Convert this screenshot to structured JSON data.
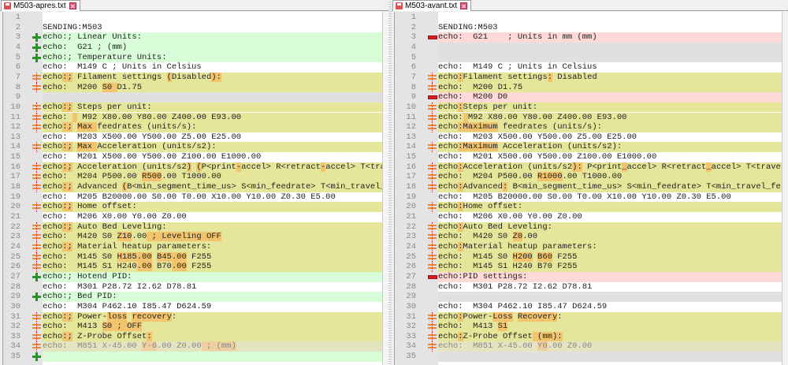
{
  "left": {
    "tab_label": "M503-apres.txt",
    "lines": [
      {
        "n": "1",
        "type": "normal",
        "segs": []
      },
      {
        "n": "2",
        "type": "normal",
        "segs": [
          {
            "t": "SENDING:M503"
          }
        ]
      },
      {
        "n": "3",
        "type": "add",
        "segs": [
          {
            "t": "echo:; Linear Units:"
          }
        ]
      },
      {
        "n": "4",
        "type": "add",
        "segs": [
          {
            "t": "echo:  G21 ; (mm)"
          }
        ]
      },
      {
        "n": "5",
        "type": "add",
        "segs": [
          {
            "t": "echo:; Temperature Units:"
          }
        ]
      },
      {
        "n": "6",
        "type": "normal",
        "segs": [
          {
            "t": "echo:  M149 C ; Units in Celsius"
          }
        ]
      },
      {
        "n": "7",
        "type": "chg",
        "segs": [
          {
            "t": "echo"
          },
          {
            "t": ":;",
            "h": true
          },
          {
            "t": " Filament settings "
          },
          {
            "t": "(",
            "h": true
          },
          {
            "t": "Disabled"
          },
          {
            "t": "):",
            "h": true
          }
        ]
      },
      {
        "n": "8",
        "type": "chg",
        "segs": [
          {
            "t": "echo:  M200 "
          },
          {
            "t": "S0 ",
            "h": true
          },
          {
            "t": "D1.75"
          }
        ]
      },
      {
        "n": "9",
        "type": "gap",
        "segs": []
      },
      {
        "n": "10",
        "type": "chg",
        "segs": [
          {
            "t": "echo"
          },
          {
            "t": ":;",
            "h": true
          },
          {
            "t": " Steps per unit:"
          }
        ]
      },
      {
        "n": "11",
        "type": "chg",
        "segs": [
          {
            "t": "echo: "
          },
          {
            "t": " ",
            "h": true
          },
          {
            "t": " M92 X80.00 Y80.00 Z400.00 E93.00"
          }
        ]
      },
      {
        "n": "12",
        "type": "chg",
        "segs": [
          {
            "t": "echo"
          },
          {
            "t": ":;",
            "h": true
          },
          {
            "t": " "
          },
          {
            "t": "Max ",
            "h": true
          },
          {
            "t": "feedrates (units/s):"
          }
        ]
      },
      {
        "n": "13",
        "type": "normal",
        "segs": [
          {
            "t": "echo:  M203 X500.00 Y500.00 Z5.00 E25.00"
          }
        ]
      },
      {
        "n": "14",
        "type": "chg",
        "segs": [
          {
            "t": "echo"
          },
          {
            "t": ":;",
            "h": true
          },
          {
            "t": " "
          },
          {
            "t": "Max ",
            "h": true
          },
          {
            "t": "Acceleration (units/s2):"
          }
        ]
      },
      {
        "n": "15",
        "type": "normal",
        "segs": [
          {
            "t": "echo:  M201 X500.00 Y500.00 Z100.00 E1000.00"
          }
        ]
      },
      {
        "n": "16",
        "type": "chg",
        "segs": [
          {
            "t": "echo"
          },
          {
            "t": ":;",
            "h": true
          },
          {
            "t": " Acceleration (units/s2"
          },
          {
            "t": ")",
            "h": true
          },
          {
            "t": " "
          },
          {
            "t": "(",
            "h": true
          },
          {
            "t": "P<print"
          },
          {
            "t": "-",
            "h": true
          },
          {
            "t": "accel> R<retract"
          },
          {
            "t": "-",
            "h": true
          },
          {
            "t": "accel> T<tra"
          }
        ]
      },
      {
        "n": "17",
        "type": "chg",
        "segs": [
          {
            "t": "echo:  M204 P500.00 "
          },
          {
            "t": "R500",
            "h": true
          },
          {
            "t": ".00 T1000.00"
          }
        ]
      },
      {
        "n": "18",
        "type": "chg",
        "segs": [
          {
            "t": "echo"
          },
          {
            "t": ":;",
            "h": true
          },
          {
            "t": " Advanced "
          },
          {
            "t": "(",
            "h": true
          },
          {
            "t": "B<min_segment_time_us> S<min_feedrate> T<min_travel_"
          }
        ]
      },
      {
        "n": "19",
        "type": "normal",
        "segs": [
          {
            "t": "echo:  M205 B20000.00 S0.00 T0.00 X10.00 Y10.00 Z0.30 E5.00"
          }
        ]
      },
      {
        "n": "20",
        "type": "chg",
        "segs": [
          {
            "t": "echo"
          },
          {
            "t": ":;",
            "h": true
          },
          {
            "t": " Home offset:"
          }
        ]
      },
      {
        "n": "21",
        "type": "normal",
        "segs": [
          {
            "t": "echo:  M206 X0.00 Y0.00 Z0.00"
          }
        ]
      },
      {
        "n": "22",
        "type": "chg",
        "segs": [
          {
            "t": "echo"
          },
          {
            "t": ":;",
            "h": true
          },
          {
            "t": " Auto Bed Leveling:"
          }
        ]
      },
      {
        "n": "23",
        "type": "chg",
        "segs": [
          {
            "t": "echo:  M420 S0 "
          },
          {
            "t": "Z10",
            "h": true
          },
          {
            "t": ".00"
          },
          {
            "t": " ; Leveling OFF",
            "h": true
          }
        ]
      },
      {
        "n": "24",
        "type": "chg",
        "segs": [
          {
            "t": "echo"
          },
          {
            "t": ":;",
            "h": true
          },
          {
            "t": " Material heatup parameters:"
          }
        ]
      },
      {
        "n": "25",
        "type": "chg",
        "segs": [
          {
            "t": "echo:  M145 S0 "
          },
          {
            "t": "H185.00",
            "h": true
          },
          {
            "t": " "
          },
          {
            "t": "B45.00",
            "h": true
          },
          {
            "t": " F255"
          }
        ]
      },
      {
        "n": "26",
        "type": "chg",
        "segs": [
          {
            "t": "echo:  M145 S1 H240"
          },
          {
            "t": ".00",
            "h": true
          },
          {
            "t": " B70"
          },
          {
            "t": ".00",
            "h": true
          },
          {
            "t": " F255"
          }
        ]
      },
      {
        "n": "27",
        "type": "add",
        "segs": [
          {
            "t": "echo:; Hotend PID:"
          }
        ]
      },
      {
        "n": "28",
        "type": "normal",
        "segs": [
          {
            "t": "echo:  M301 P28.72 I2.62 D78.81"
          }
        ]
      },
      {
        "n": "29",
        "type": "add",
        "segs": [
          {
            "t": "echo:; Bed PID:"
          }
        ]
      },
      {
        "n": "30",
        "type": "normal",
        "segs": [
          {
            "t": "echo:  M304 P462.10 I85.47 D624.59"
          }
        ]
      },
      {
        "n": "31",
        "type": "chg",
        "segs": [
          {
            "t": "echo"
          },
          {
            "t": ":;",
            "h": true
          },
          {
            "t": " Power-"
          },
          {
            "t": "loss",
            "h": true
          },
          {
            "t": " "
          },
          {
            "t": "recovery",
            "h": true
          },
          {
            "t": ":"
          }
        ]
      },
      {
        "n": "32",
        "type": "chg",
        "segs": [
          {
            "t": "echo:  M413 "
          },
          {
            "t": "S0 ; OFF",
            "h": true
          }
        ]
      },
      {
        "n": "33",
        "type": "chg",
        "segs": [
          {
            "t": "echo"
          },
          {
            "t": ":;",
            "h": true
          },
          {
            "t": " Z-Probe Offset"
          },
          {
            "t": ":",
            "h": true
          }
        ]
      },
      {
        "n": "34",
        "type": "dim",
        "marker": "chg",
        "segs": [
          {
            "t": "echo:  M851 X-45.00 "
          },
          {
            "t": "Y-6",
            "h": true
          },
          {
            "t": ".00 Z0.00"
          },
          {
            "t": " ; (mm)",
            "h": true
          }
        ]
      },
      {
        "n": "35",
        "type": "add",
        "segs": []
      }
    ]
  },
  "right": {
    "tab_label": "M503-avant.txt",
    "lines": [
      {
        "n": "1",
        "type": "normal",
        "segs": []
      },
      {
        "n": "2",
        "type": "normal",
        "segs": [
          {
            "t": "SENDING:M503"
          }
        ]
      },
      {
        "n": "3",
        "type": "del",
        "segs": [
          {
            "t": "echo:  G21    ; Units in mm (mm)"
          }
        ]
      },
      {
        "n": "4",
        "type": "gap",
        "segs": []
      },
      {
        "n": "5",
        "type": "gap",
        "segs": []
      },
      {
        "n": "6",
        "type": "normal",
        "segs": [
          {
            "t": "echo:  M149 C ; Units in Celsius"
          }
        ]
      },
      {
        "n": "7",
        "type": "chg",
        "segs": [
          {
            "t": "echo"
          },
          {
            "t": ":",
            "h": true
          },
          {
            "t": "Filament settings"
          },
          {
            "t": ":",
            "h": true
          },
          {
            "t": " Disabled"
          }
        ]
      },
      {
        "n": "8",
        "type": "chg",
        "segs": [
          {
            "t": "echo:  M200 D1.75"
          }
        ]
      },
      {
        "n": "9",
        "type": "del",
        "segs": [
          {
            "t": "echo:  M200 D0"
          }
        ]
      },
      {
        "n": "10",
        "type": "chg",
        "segs": [
          {
            "t": "echo"
          },
          {
            "t": ":",
            "h": true
          },
          {
            "t": "Steps per unit:"
          }
        ]
      },
      {
        "n": "11",
        "type": "chg",
        "segs": [
          {
            "t": "echo:"
          },
          {
            "t": " ",
            "h": true
          },
          {
            "t": "M92 X80.00 Y80.00 Z400.00 E93.00"
          }
        ]
      },
      {
        "n": "12",
        "type": "chg",
        "segs": [
          {
            "t": "echo"
          },
          {
            "t": ":Maximum",
            "h": true
          },
          {
            "t": " feedrates (units/s):"
          }
        ]
      },
      {
        "n": "13",
        "type": "normal",
        "segs": [
          {
            "t": "echo:  M203 X500.00 Y500.00 Z5.00 E25.00"
          }
        ]
      },
      {
        "n": "14",
        "type": "chg",
        "segs": [
          {
            "t": "echo"
          },
          {
            "t": ":Maximum",
            "h": true
          },
          {
            "t": " Acceleration (units/s2):"
          }
        ]
      },
      {
        "n": "15",
        "type": "normal",
        "segs": [
          {
            "t": "echo:  M201 X500.00 Y500.00 Z100.00 E1000.00"
          }
        ]
      },
      {
        "n": "16",
        "type": "chg",
        "segs": [
          {
            "t": "echo"
          },
          {
            "t": ":",
            "h": true
          },
          {
            "t": "Acceleration (units/s2"
          },
          {
            "t": "):",
            "h": true
          },
          {
            "t": " P<print"
          },
          {
            "t": "_",
            "h": true
          },
          {
            "t": "accel> R<retract"
          },
          {
            "t": "_",
            "h": true
          },
          {
            "t": "accel> T<travel"
          }
        ]
      },
      {
        "n": "17",
        "type": "chg",
        "segs": [
          {
            "t": "echo:  M204 P500.00 "
          },
          {
            "t": "R1000",
            "h": true
          },
          {
            "t": ".00 T1000.00"
          }
        ]
      },
      {
        "n": "18",
        "type": "chg",
        "segs": [
          {
            "t": "echo"
          },
          {
            "t": ":",
            "h": true
          },
          {
            "t": "Advanced"
          },
          {
            "t": ":",
            "h": true
          },
          {
            "t": " B<min_segment_time_us> S<min_feedrate> T<min_travel_fe"
          }
        ]
      },
      {
        "n": "19",
        "type": "normal",
        "segs": [
          {
            "t": "echo:  M205 B20000.00 S0.00 T0.00 X10.00 Y10.00 Z0.30 E5.00"
          }
        ]
      },
      {
        "n": "20",
        "type": "chg",
        "segs": [
          {
            "t": "echo"
          },
          {
            "t": ":",
            "h": true
          },
          {
            "t": "Home offset:"
          }
        ]
      },
      {
        "n": "21",
        "type": "normal",
        "segs": [
          {
            "t": "echo:  M206 X0.00 Y0.00 Z0.00"
          }
        ]
      },
      {
        "n": "22",
        "type": "chg",
        "segs": [
          {
            "t": "echo"
          },
          {
            "t": ":",
            "h": true
          },
          {
            "t": "Auto Bed Leveling:"
          }
        ]
      },
      {
        "n": "23",
        "type": "chg",
        "segs": [
          {
            "t": "echo:  M420 S0 "
          },
          {
            "t": "Z0",
            "h": true
          },
          {
            "t": ".00"
          }
        ]
      },
      {
        "n": "24",
        "type": "chg",
        "segs": [
          {
            "t": "echo"
          },
          {
            "t": ":",
            "h": true
          },
          {
            "t": "Material heatup parameters:"
          }
        ]
      },
      {
        "n": "25",
        "type": "chg",
        "segs": [
          {
            "t": "echo:  M145 S0 "
          },
          {
            "t": "H200",
            "h": true
          },
          {
            "t": " "
          },
          {
            "t": "B60",
            "h": true
          },
          {
            "t": " F255"
          }
        ]
      },
      {
        "n": "26",
        "type": "chg",
        "segs": [
          {
            "t": "echo:  M145 S1 H240 B70 F255"
          }
        ]
      },
      {
        "n": "27",
        "type": "del",
        "segs": [
          {
            "t": "echo:PID settings:"
          }
        ]
      },
      {
        "n": "28",
        "type": "normal",
        "segs": [
          {
            "t": "echo:  M301 P28.72 I2.62 D78.81"
          }
        ]
      },
      {
        "n": "29",
        "type": "gap",
        "segs": []
      },
      {
        "n": "30",
        "type": "normal",
        "segs": [
          {
            "t": "echo:  M304 P462.10 I85.47 D624.59"
          }
        ]
      },
      {
        "n": "31",
        "type": "chg",
        "segs": [
          {
            "t": "echo"
          },
          {
            "t": ":",
            "h": true
          },
          {
            "t": "Power-"
          },
          {
            "t": "Loss",
            "h": true
          },
          {
            "t": " "
          },
          {
            "t": "Recovery",
            "h": true
          },
          {
            "t": ":"
          }
        ]
      },
      {
        "n": "32",
        "type": "chg",
        "segs": [
          {
            "t": "echo:  M413 "
          },
          {
            "t": "S1",
            "h": true
          }
        ]
      },
      {
        "n": "33",
        "type": "chg",
        "segs": [
          {
            "t": "echo"
          },
          {
            "t": ":",
            "h": true
          },
          {
            "t": "Z-Probe Offset"
          },
          {
            "t": " (mm):",
            "h": true
          }
        ]
      },
      {
        "n": "34",
        "type": "dim",
        "marker": "chg",
        "segs": [
          {
            "t": "echo:  M851 X-45.00 "
          },
          {
            "t": "Y0",
            "h": true
          },
          {
            "t": ".00 Z0.00"
          }
        ]
      },
      {
        "n": "35",
        "type": "gap",
        "segs": []
      }
    ]
  },
  "colors": {
    "added": "#d9fdd9",
    "changed": "#e6e69a",
    "removed": "#ffd8d8",
    "highlight": "#f2c46e"
  }
}
